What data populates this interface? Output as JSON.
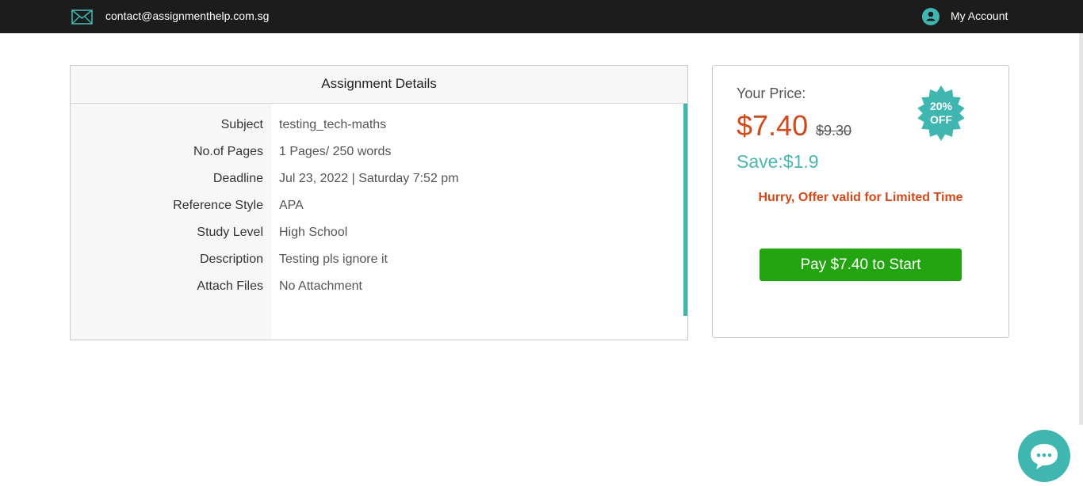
{
  "topbar": {
    "email": "contact@assignmenthelp.com.sg",
    "account_label": "My Account",
    "mail_icon": "mail-icon",
    "account_icon": "user-icon"
  },
  "details": {
    "title": "Assignment Details",
    "rows": [
      {
        "label": "Subject",
        "value": "testing_tech-maths"
      },
      {
        "label": "No.of Pages",
        "value": "1 Pages/ 250 words"
      },
      {
        "label": "Deadline",
        "value": "Jul 23, 2022 | Saturday 7:52 pm"
      },
      {
        "label": "Reference Style",
        "value": "APA"
      },
      {
        "label": "Study Level",
        "value": "High School"
      },
      {
        "label": "Description",
        "value": "Testing pls ignore it"
      },
      {
        "label": "Attach Files",
        "value": "No Attachment"
      }
    ]
  },
  "pricing": {
    "your_price_label": "Your Price:",
    "current_price": "$7.40",
    "original_price": "$9.30",
    "save_text": "Save:$1.9",
    "badge_line1": "20%",
    "badge_line2": "OFF",
    "offer_text": "Hurry, Offer valid for Limited Time",
    "pay_button": "Pay $7.40 to Start"
  },
  "colors": {
    "accent": "#3fb6b0",
    "price": "#d24818",
    "pay_button": "#22a510",
    "topbar": "#1c1c1c"
  },
  "chat_icon": "chat-bubble-icon"
}
